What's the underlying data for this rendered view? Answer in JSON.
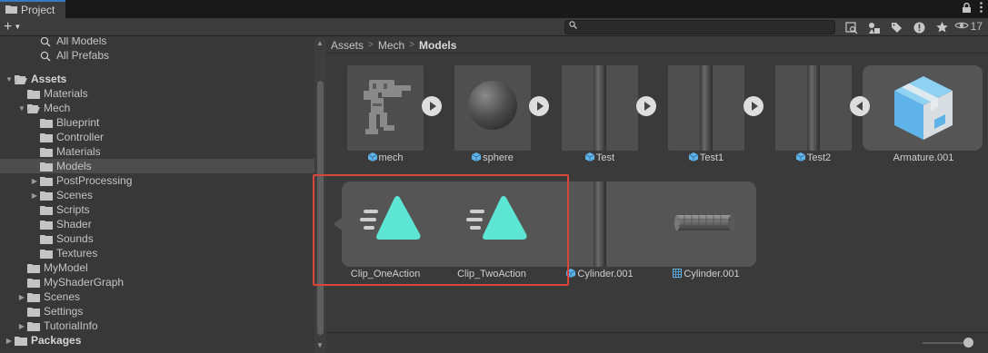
{
  "window": {
    "tab_title": "Project",
    "lock_icon": "lock-icon",
    "menu_icon": "kebab-menu-icon"
  },
  "toolbar": {
    "create_label": "+",
    "search_placeholder": "",
    "hidden_packages_count": "17"
  },
  "tree": {
    "items": [
      {
        "label": "All Models",
        "depth": 2,
        "kind": "search"
      },
      {
        "label": "All Prefabs",
        "depth": 2,
        "kind": "search"
      },
      {
        "label": "Assets",
        "depth": 0,
        "kind": "folder-open",
        "bold": true
      },
      {
        "label": "Materials",
        "depth": 1,
        "kind": "folder"
      },
      {
        "label": "Mech",
        "depth": 1,
        "kind": "folder-open"
      },
      {
        "label": "Blueprint",
        "depth": 2,
        "kind": "folder"
      },
      {
        "label": "Controller",
        "depth": 2,
        "kind": "folder"
      },
      {
        "label": "Materials",
        "depth": 2,
        "kind": "folder"
      },
      {
        "label": "Models",
        "depth": 2,
        "kind": "folder",
        "selected": true
      },
      {
        "label": "PostProcessing",
        "depth": 2,
        "kind": "folder",
        "collapsed": true
      },
      {
        "label": "Scenes",
        "depth": 2,
        "kind": "folder",
        "collapsed": true
      },
      {
        "label": "Scripts",
        "depth": 2,
        "kind": "folder"
      },
      {
        "label": "Shader",
        "depth": 2,
        "kind": "folder"
      },
      {
        "label": "Sounds",
        "depth": 2,
        "kind": "folder"
      },
      {
        "label": "Textures",
        "depth": 2,
        "kind": "folder"
      },
      {
        "label": "MyModel",
        "depth": 1,
        "kind": "folder"
      },
      {
        "label": "MyShaderGraph",
        "depth": 1,
        "kind": "folder"
      },
      {
        "label": "Scenes",
        "depth": 1,
        "kind": "folder",
        "collapsed": true
      },
      {
        "label": "Settings",
        "depth": 1,
        "kind": "folder"
      },
      {
        "label": "TutorialInfo",
        "depth": 1,
        "kind": "folder",
        "collapsed": true
      },
      {
        "label": "Packages",
        "depth": 0,
        "kind": "folder",
        "bold": true,
        "collapsed": true
      }
    ]
  },
  "breadcrumb": {
    "parts": [
      "Assets",
      "Mech",
      "Models"
    ]
  },
  "assets": [
    {
      "name": "mech",
      "type_icon": "mesh-prefab-icon"
    },
    {
      "name": "sphere",
      "type_icon": "mesh-prefab-icon"
    },
    {
      "name": "Test",
      "type_icon": "mesh-prefab-icon"
    },
    {
      "name": "Test1",
      "type_icon": "mesh-prefab-icon"
    },
    {
      "name": "Test2",
      "type_icon": "mesh-prefab-icon"
    },
    {
      "name": "Armature.001",
      "type_icon": ""
    },
    {
      "name": "Clip_OneAction",
      "type_icon": ""
    },
    {
      "name": "Clip_TwoAction",
      "type_icon": ""
    },
    {
      "name": "Cylinder.001",
      "type_icon": "mesh-prefab-icon"
    },
    {
      "name": "Cylinder.001",
      "type_icon": "mesh-grid-icon"
    }
  ],
  "colors": {
    "accent": "#3a79bb",
    "highlight": "#d8453a",
    "anim_clip": "#5ee6d5",
    "prefab_blue": "#5fb3e8"
  }
}
